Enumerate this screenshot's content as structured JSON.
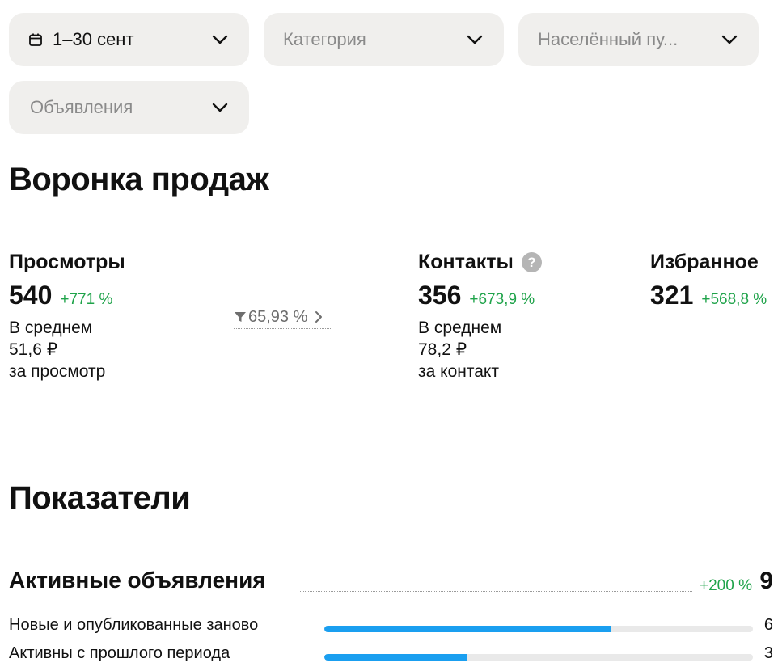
{
  "filters": {
    "date": {
      "label": "1–30 сент",
      "icon": "calendar-icon"
    },
    "category": {
      "placeholder": "Категория"
    },
    "city": {
      "placeholder": "Населённый пу..."
    },
    "ads": {
      "placeholder": "Объявления"
    }
  },
  "funnel": {
    "title": "Воронка продаж",
    "views": {
      "name": "Просмотры",
      "value": "540",
      "change": "+771 %",
      "avg_line1": "В среднем",
      "avg_line2": "51,6 ₽",
      "avg_line3": "за просмотр"
    },
    "conversion": {
      "value": "65,93 %"
    },
    "contacts": {
      "name": "Контакты",
      "help": "?",
      "value": "356",
      "change": "+673,9 %",
      "avg_line1": "В среднем",
      "avg_line2": "78,2 ₽",
      "avg_line3": "за контакт"
    },
    "favorites": {
      "name": "Избранное",
      "value": "321",
      "change": "+568,8 %"
    }
  },
  "metrics": {
    "title": "Показатели",
    "active": {
      "title": "Активные объявления",
      "change": "+200 %",
      "value": "9"
    },
    "breakdown": [
      {
        "label": "Новые и опубликованные заново",
        "value": "6",
        "fraction": 0.667
      },
      {
        "label": "Активны с прошлого периода",
        "value": "3",
        "fraction": 0.333
      }
    ]
  },
  "colors": {
    "positive": "#1fa34a",
    "bar": "#1a9ff0",
    "filter_bg": "#f0efed"
  }
}
